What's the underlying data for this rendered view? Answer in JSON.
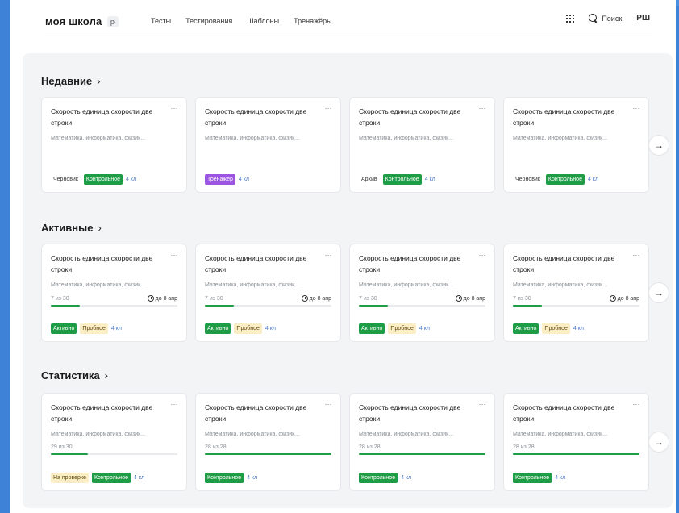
{
  "header": {
    "logo": "моя школа",
    "logo_badge": "р",
    "nav": [
      "Тесты",
      "Тестирования",
      "Шаблоны",
      "Тренажёры"
    ],
    "search_label": "Поиск",
    "avatar": "РШ"
  },
  "sections": {
    "recent": {
      "title": "Недавние",
      "cards": [
        {
          "title": "Скорость единица скорости две строки",
          "subjects": "Математика, информатика, физик...",
          "tags": [
            {
              "label": "Черновик",
              "style": "plain"
            },
            {
              "label": "Контрольное",
              "style": "green"
            }
          ],
          "count": "4 кл"
        },
        {
          "title": "Скорость единица скорости две строки",
          "subjects": "Математика, информатика, физик...",
          "tags": [
            {
              "label": "Тренажёр",
              "style": "purple"
            }
          ],
          "count": "4 кл"
        },
        {
          "title": "Скорость единица скорости две строки",
          "subjects": "Математика, информатика, физик...",
          "tags": [
            {
              "label": "Архив",
              "style": "plain"
            },
            {
              "label": "Контрольное",
              "style": "green"
            }
          ],
          "count": "4 кл"
        },
        {
          "title": "Скорость единица скорости две строки",
          "subjects": "Математика, информатика, физик...",
          "tags": [
            {
              "label": "Черновик",
              "style": "plain"
            },
            {
              "label": "Контрольное",
              "style": "green"
            }
          ],
          "count": "4 кл"
        }
      ]
    },
    "active": {
      "title": "Активные",
      "cards": [
        {
          "title": "Скорость единица скорости две строки",
          "subjects": "Математика, информатика, физик...",
          "progress_text": "7 из 30",
          "deadline": "до 8 апр",
          "progress": 0.23,
          "tags": [
            {
              "label": "Активно",
              "style": "green"
            },
            {
              "label": "Пробное",
              "style": "yellow"
            }
          ],
          "count": "4 кл"
        },
        {
          "title": "Скорость единица скорости две строки",
          "subjects": "Математика, информатика, физик...",
          "progress_text": "7 из 30",
          "deadline": "до 8 апр",
          "progress": 0.23,
          "tags": [
            {
              "label": "Активно",
              "style": "green"
            },
            {
              "label": "Пробное",
              "style": "yellow"
            }
          ],
          "count": "4 кл"
        },
        {
          "title": "Скорость единица скорости две строки",
          "subjects": "Математика, информатика, физик...",
          "progress_text": "7 из 30",
          "deadline": "до 8 апр",
          "progress": 0.23,
          "tags": [
            {
              "label": "Активно",
              "style": "green"
            },
            {
              "label": "Пробное",
              "style": "yellow"
            }
          ],
          "count": "4 кл"
        },
        {
          "title": "Скорость единица скорости две строки",
          "subjects": "Математика, информатика, физик...",
          "progress_text": "7 из 30",
          "deadline": "до 8 апр",
          "progress": 0.23,
          "tags": [
            {
              "label": "Активно",
              "style": "green"
            },
            {
              "label": "Пробное",
              "style": "yellow"
            }
          ],
          "count": "4 кл"
        }
      ]
    },
    "stats": {
      "title": "Статистика",
      "cards": [
        {
          "title": "Скорость единица скорости две строки",
          "subjects": "Математика, информатика, физик...",
          "progress_text": "29 из 30",
          "progress": 0.29,
          "tags": [
            {
              "label": "На проверке",
              "style": "yellow"
            },
            {
              "label": "Контрольное",
              "style": "green"
            }
          ],
          "count": "4 кл"
        },
        {
          "title": "Скорость единица скорости две строки",
          "subjects": "Математика, информатика, физик...",
          "progress_text": "28 из 28",
          "progress": 1.0,
          "tags": [
            {
              "label": "Контрольное",
              "style": "green"
            }
          ],
          "count": "4 кл"
        },
        {
          "title": "Скорость единица скорости две строки",
          "subjects": "Математика, информатика, физик...",
          "progress_text": "28 из 28",
          "progress": 1.0,
          "tags": [
            {
              "label": "Контрольное",
              "style": "green"
            }
          ],
          "count": "4 кл"
        },
        {
          "title": "Скорость единица скорости две строки",
          "subjects": "Математика, информатика, физик...",
          "progress_text": "28 из 28",
          "progress": 1.0,
          "tags": [
            {
              "label": "Контрольное",
              "style": "green"
            }
          ],
          "count": "4 кл"
        }
      ]
    }
  },
  "icons": {
    "more": "more-dots-icon",
    "next": "arrow-right-icon",
    "apps": "apps-grid-icon",
    "search": "search-icon",
    "clock": "clock-icon"
  }
}
